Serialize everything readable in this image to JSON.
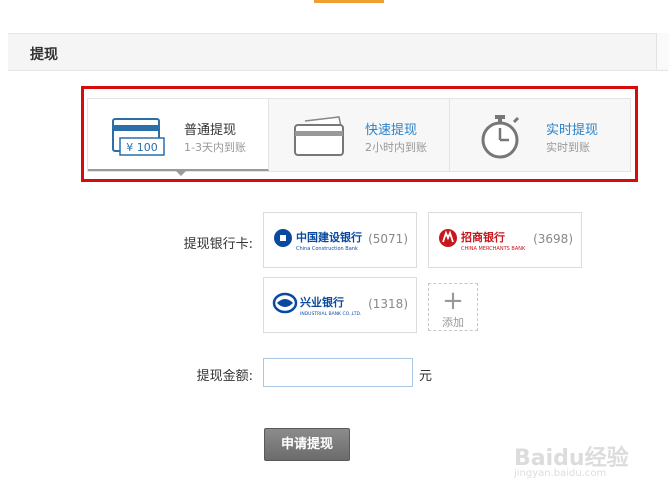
{
  "section": {
    "title": "提现"
  },
  "methods": [
    {
      "label": "普通提现",
      "sub": "1-3天内到账",
      "icon": "bank-card-100-icon",
      "icon_text": "¥ 100",
      "active": true
    },
    {
      "label": "快速提现",
      "sub": "2小时内到账",
      "icon": "card-icon",
      "active": false
    },
    {
      "label": "实时提现",
      "sub": "实时到账",
      "icon": "stopwatch-icon",
      "active": false
    }
  ],
  "bank_cards": {
    "label": "提现银行卡:",
    "items": [
      {
        "bank": "中国建设银行",
        "bank_en": "China Construction Bank",
        "tail": "(5071)",
        "color": "#0a4a9e"
      },
      {
        "bank": "招商银行",
        "bank_en": "CHINA MERCHANTS BANK",
        "tail": "(3698)",
        "color": "#c8161d"
      },
      {
        "bank": "兴业银行",
        "bank_en": "INDUSTRIAL BANK CO.,LTD.",
        "tail": "(1318)",
        "color": "#0a4a9e"
      }
    ],
    "add_label": "添加",
    "add_symbol": "+"
  },
  "amount": {
    "label": "提现金额:",
    "value": "",
    "unit": "元"
  },
  "submit": {
    "label": "申请提现"
  },
  "watermark": {
    "brand": "Baidu经验",
    "url": "jingyan.baidu.com"
  },
  "colors": {
    "highlight": "#d90a0a",
    "link": "#2a82c8",
    "accent": "#f0a030"
  }
}
